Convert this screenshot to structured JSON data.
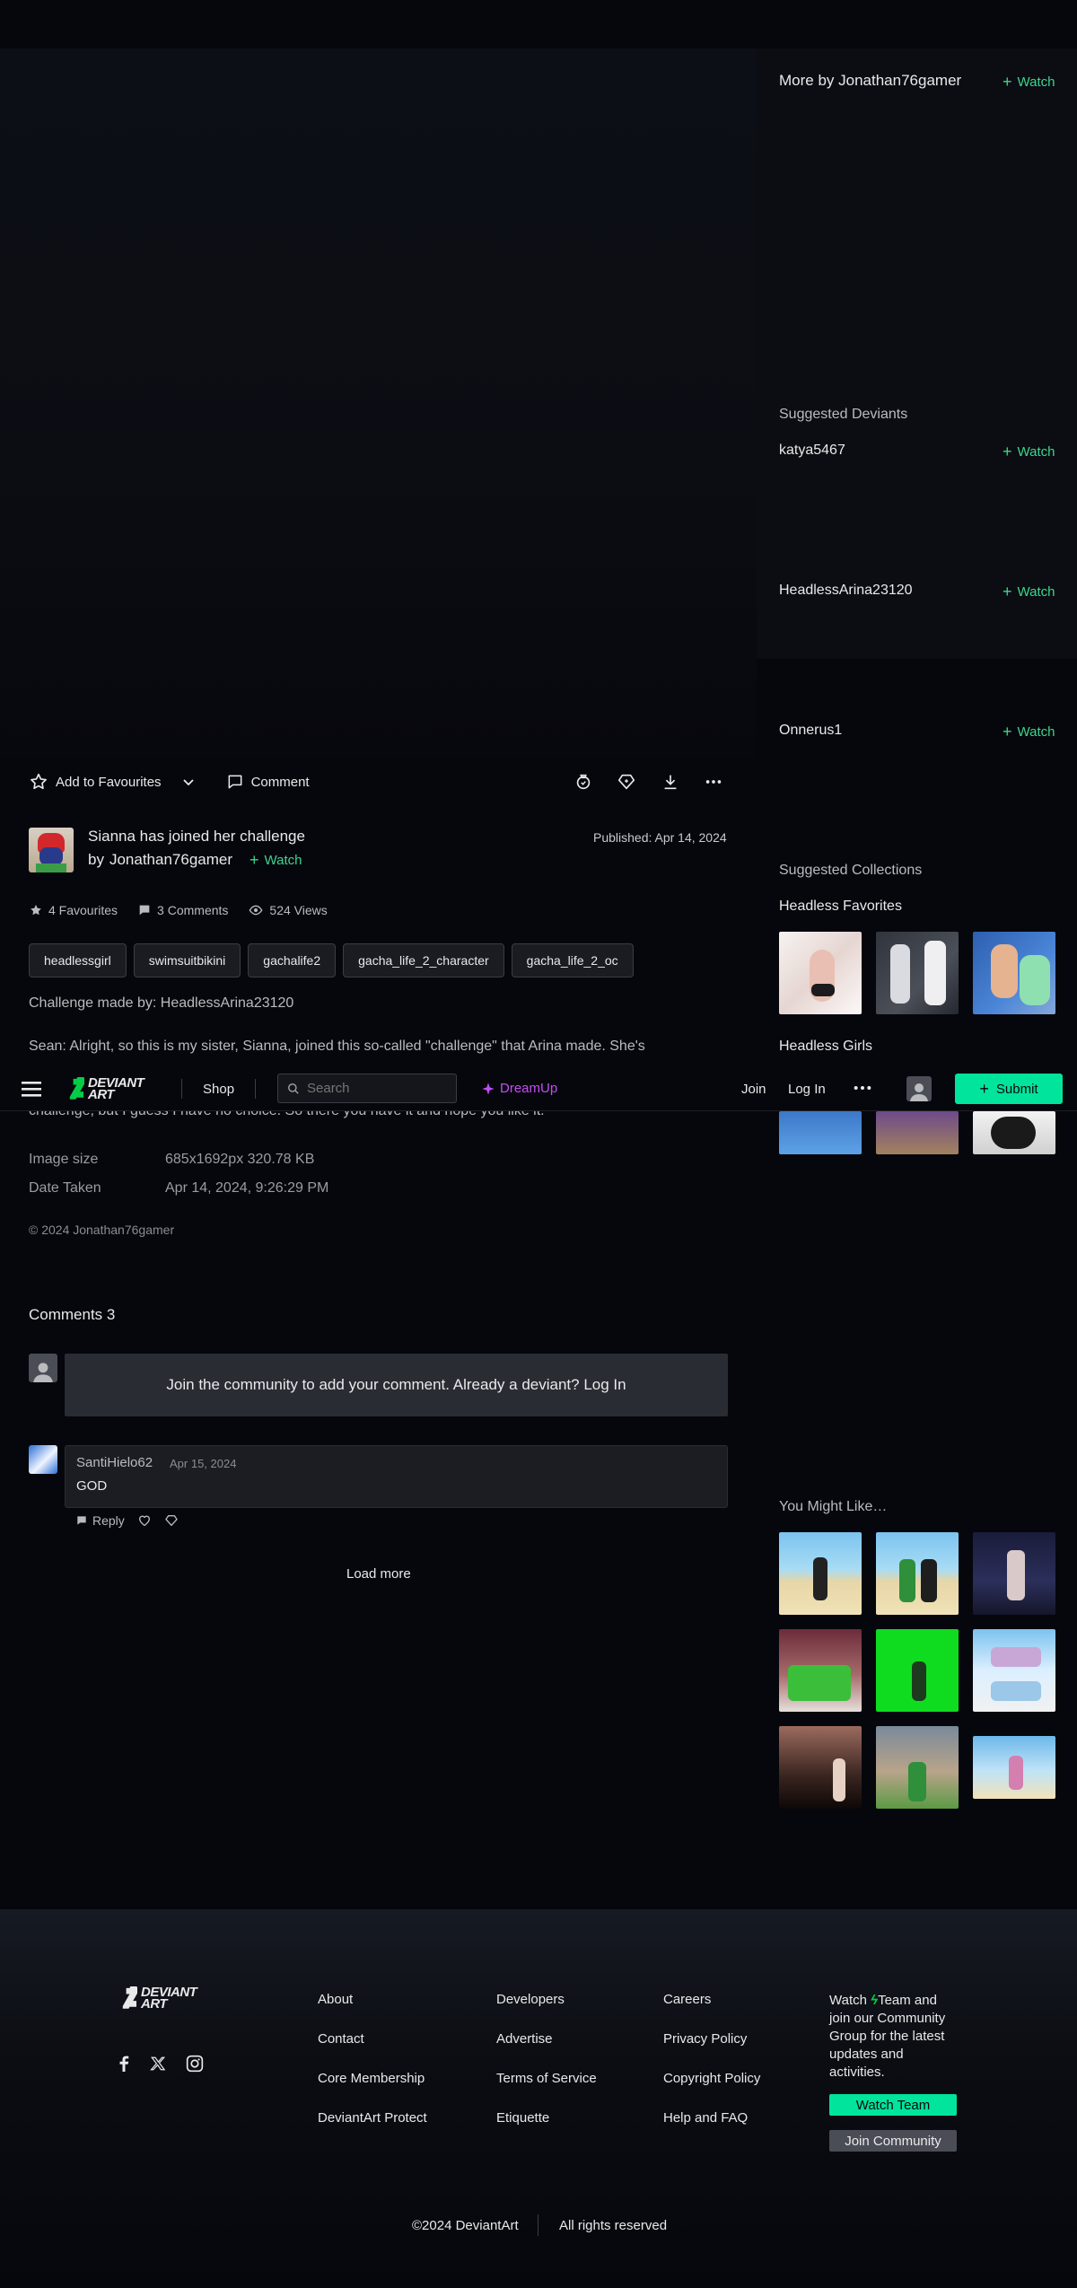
{
  "rail": {
    "more_by": "More by Jonathan76gamer",
    "watch_label": "Watch",
    "suggested_deviants_title": "Suggested Deviants",
    "suggested_deviants": [
      {
        "name": "katya5467"
      },
      {
        "name": "HeadlessArina23120"
      },
      {
        "name": "Onnerus1"
      }
    ],
    "suggested_collections_title": "Suggested Collections",
    "collections": [
      {
        "title": "Headless Favorites"
      },
      {
        "title": "Headless Girls"
      }
    ],
    "you_might_like_title": "You Might Like…"
  },
  "actions": {
    "favourite": "Add to Favourites",
    "comment": "Comment"
  },
  "deviation": {
    "title": "Sianna has joined her challenge",
    "by_prefix": "by",
    "author": "Jonathan76gamer",
    "watch": "Watch",
    "published": "Published: Apr 14, 2024",
    "stats": {
      "favourites": "4 Favourites",
      "comments": "3 Comments",
      "views": "524 Views"
    },
    "tags": [
      "headlessgirl",
      "swimsuitbikini",
      "gachalife2",
      "gacha_life_2_character",
      "gacha_life_2_oc"
    ],
    "description_1": "Challenge made by: HeadlessArina23120",
    "description_2": "Sean: Alright, so this is my sister, Sianna, joined this so-called \"challenge\" that Arina made. She's",
    "description_3": "challenge, but I guess I have no choice. So there you have it and hope you like it.",
    "image_size_label": "Image size",
    "image_size_value": "685x1692px 320.78 KB",
    "date_taken_label": "Date Taken",
    "date_taken_value": "Apr 14, 2024, 9:26:29 PM",
    "copyright": "© 2024 Jonathan76gamer"
  },
  "navbar": {
    "logo": "DEVIANT ART",
    "shop": "Shop",
    "search_placeholder": "Search",
    "dreamup": "DreamUp",
    "join": "Join",
    "login": "Log In",
    "submit": "Submit"
  },
  "comments": {
    "title": "Comments 3",
    "prompt": "Join the community to add your comment. Already a deviant? Log In",
    "items": [
      {
        "user": "SantiHielo62",
        "date": "Apr 15, 2024",
        "text": "GOD",
        "reply": "Reply"
      }
    ],
    "load_more": "Load more"
  },
  "footer": {
    "logo": "DEVIANT ART",
    "col1": [
      "About",
      "Contact",
      "Core Membership",
      "DeviantArt Protect"
    ],
    "col2": [
      "Developers",
      "Advertise",
      "Terms of Service",
      "Etiquette"
    ],
    "col3": [
      "Careers",
      "Privacy Policy",
      "Copyright Policy",
      "Help and FAQ"
    ],
    "watch_team_text_a": "Watch",
    "watch_team_text_b": "Team and join our Community Group for the latest updates and activities.",
    "watch_team_btn": "Watch Team",
    "join_community_btn": "Join Community",
    "copyright": "©2024 DeviantArt",
    "rights": "All rights reserved"
  },
  "colors": {
    "accent_green": "#3dd68c",
    "submit_bg": "#00e59b",
    "dreamup": "#c54cf5",
    "bg": "#06070d"
  }
}
